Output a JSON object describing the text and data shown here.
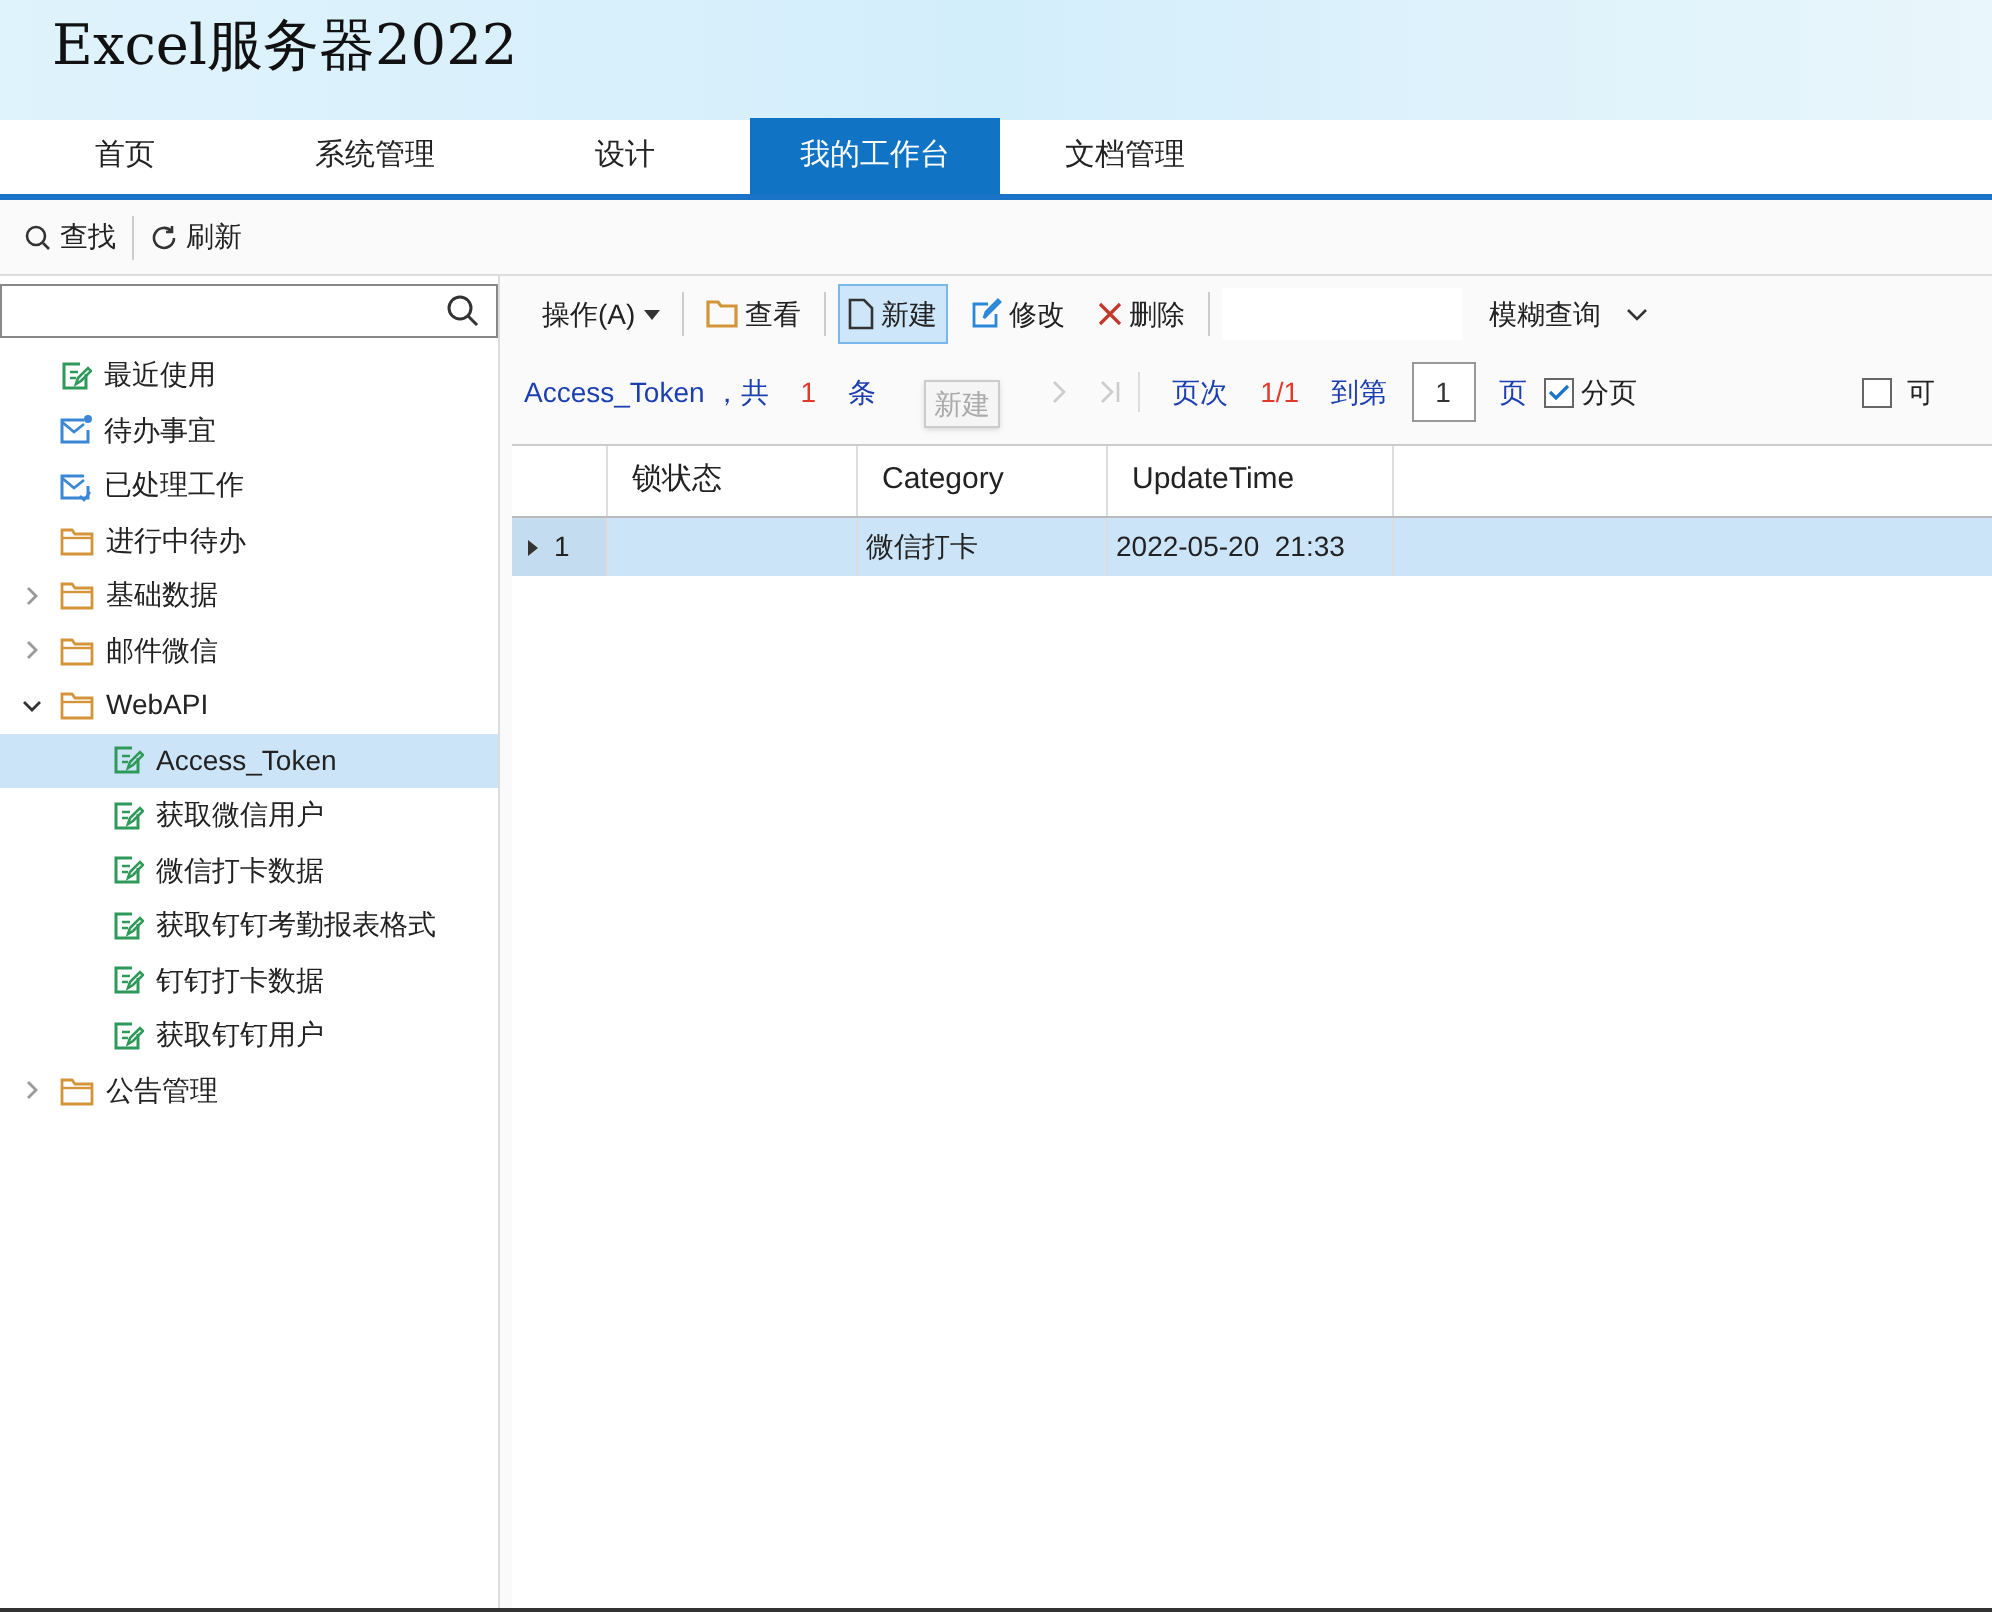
{
  "app_title": "Excel服务器2022",
  "tabs": [
    {
      "label": "首页",
      "selected": false
    },
    {
      "label": "系统管理",
      "selected": false
    },
    {
      "label": "设计",
      "selected": false
    },
    {
      "label": "我的工作台",
      "selected": true
    },
    {
      "label": "文档管理",
      "selected": false
    }
  ],
  "main_toolbar": [
    {
      "kind": "search",
      "label": "查找"
    },
    {
      "kind": "refresh",
      "label": "刷新"
    }
  ],
  "tree": [
    {
      "label": "最近使用",
      "kind": "doc",
      "selected": false
    },
    {
      "label": "待办事宜",
      "kind": "mail-dot",
      "selected": false
    },
    {
      "label": "已处理工作",
      "kind": "mail-check",
      "selected": false
    },
    {
      "label": "进行中待办",
      "kind": "folder",
      "selected": false
    },
    {
      "label": "基础数据",
      "kind": "folder",
      "expanded": false,
      "selected": false
    },
    {
      "label": "邮件微信",
      "kind": "folder",
      "expanded": false,
      "selected": false
    },
    {
      "label": "WebAPI",
      "kind": "folder",
      "expanded": true,
      "selected": false,
      "children": [
        {
          "label": "Access_Token",
          "kind": "doc",
          "selected": true
        },
        {
          "label": "获取微信用户",
          "kind": "doc",
          "selected": false
        },
        {
          "label": "微信打卡数据",
          "kind": "doc",
          "selected": false
        },
        {
          "label": "获取钉钉考勤报表格式",
          "kind": "doc",
          "selected": false
        },
        {
          "label": "钉钉打卡数据",
          "kind": "doc",
          "selected": false
        },
        {
          "label": "获取钉钉用户",
          "kind": "doc",
          "selected": false
        }
      ]
    },
    {
      "label": "公告管理",
      "kind": "folder",
      "expanded": false,
      "selected": false
    }
  ],
  "grid_toolbar": [
    {
      "kind": "menu",
      "label": "操作(A)",
      "pressed": false
    },
    {
      "kind": "view",
      "label": "查看",
      "pressed": false
    },
    {
      "kind": "new",
      "label": "新建",
      "pressed": true
    },
    {
      "kind": "edit",
      "label": "修改",
      "pressed": false
    },
    {
      "kind": "delete",
      "label": "删除",
      "pressed": false
    }
  ],
  "query_mode": "模糊查询",
  "pager": {
    "name": "Access_Token",
    "sep": "，共",
    "count": "1",
    "unit": "条",
    "page_label": "页次",
    "page": "1/1",
    "goto_label": "到第",
    "goto_value": "1",
    "goto_unit": "页",
    "paging_label": "分页",
    "paging_checked": true,
    "extra_label": "可",
    "extra_checked": false
  },
  "tooltip": "新建",
  "table": {
    "columns": [
      "锁状态",
      "Category",
      "UpdateTime"
    ],
    "rows": [
      {
        "number": "1",
        "selected": true,
        "cells": [
          "",
          "微信打卡",
          "2022-05-20  21:33"
        ]
      }
    ]
  }
}
